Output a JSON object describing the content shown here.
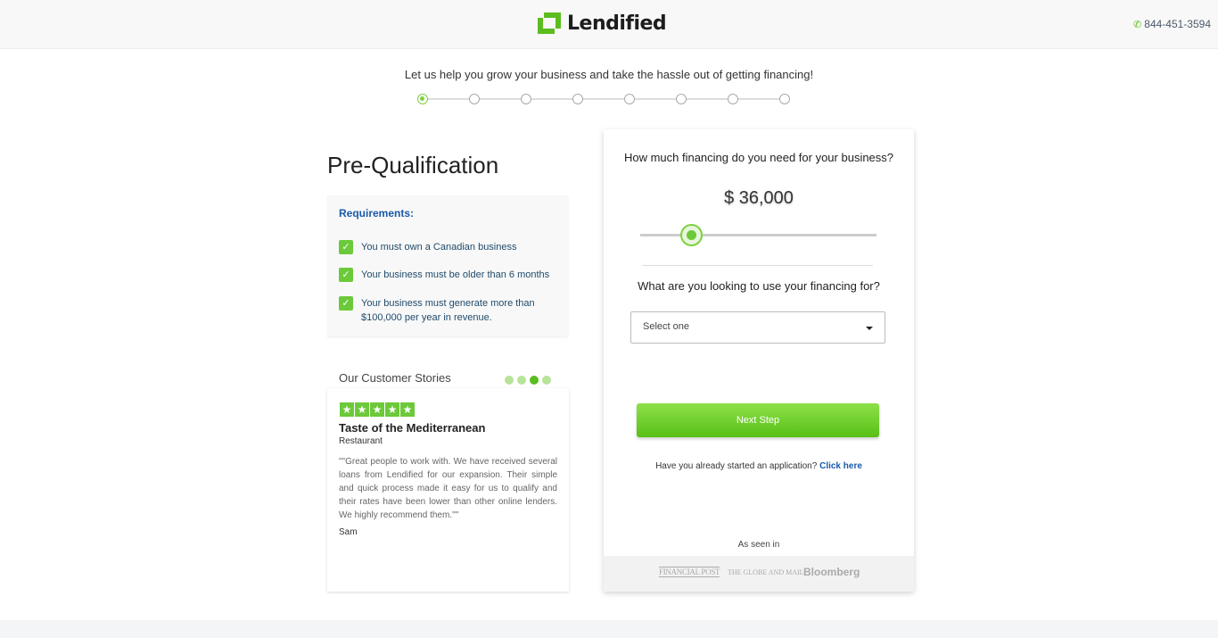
{
  "header": {
    "logo_text": "Lendified",
    "phone": "844-451-3594"
  },
  "tagline": "Let us help you grow your business and take the hassle out of getting financing!",
  "stepper": {
    "total_steps": 8,
    "current_step": 1
  },
  "page_title": "Pre-Qualification",
  "requirements": {
    "title": "Requirements:",
    "items": [
      "You must own a Canadian business",
      "Your business must be older than 6 months",
      "Your business must generate more than $100,000 per year in revenue."
    ]
  },
  "stories": {
    "title": "Our Customer Stories",
    "total": 4,
    "active_index": 2,
    "card": {
      "rating": 5,
      "name": "Taste of the Mediterranean",
      "type": "Restaurant",
      "quote": "\"\"Great people to work with. We have received several loans from Lendified for our expansion. Their simple and quick process made it easy for us to qualify and their rates have been lower than other online lenders. We highly recommend them.\"\"",
      "author": "Sam"
    }
  },
  "form": {
    "question_amount": "How much financing do you need for your business?",
    "amount_display": "$ 36,000",
    "question_use": "What are you looking to use your financing for?",
    "select_value": "Select one",
    "next_label": "Next Step",
    "already_text": "Have you already started an application?",
    "already_link": "Click here",
    "seen_in": "As seen in",
    "press": [
      "FINANCIAL POST",
      "THE GLOBE AND MAIL",
      "Bloomberg"
    ]
  },
  "colors": {
    "accent": "#6cc93a",
    "link": "#1a5aa8"
  }
}
